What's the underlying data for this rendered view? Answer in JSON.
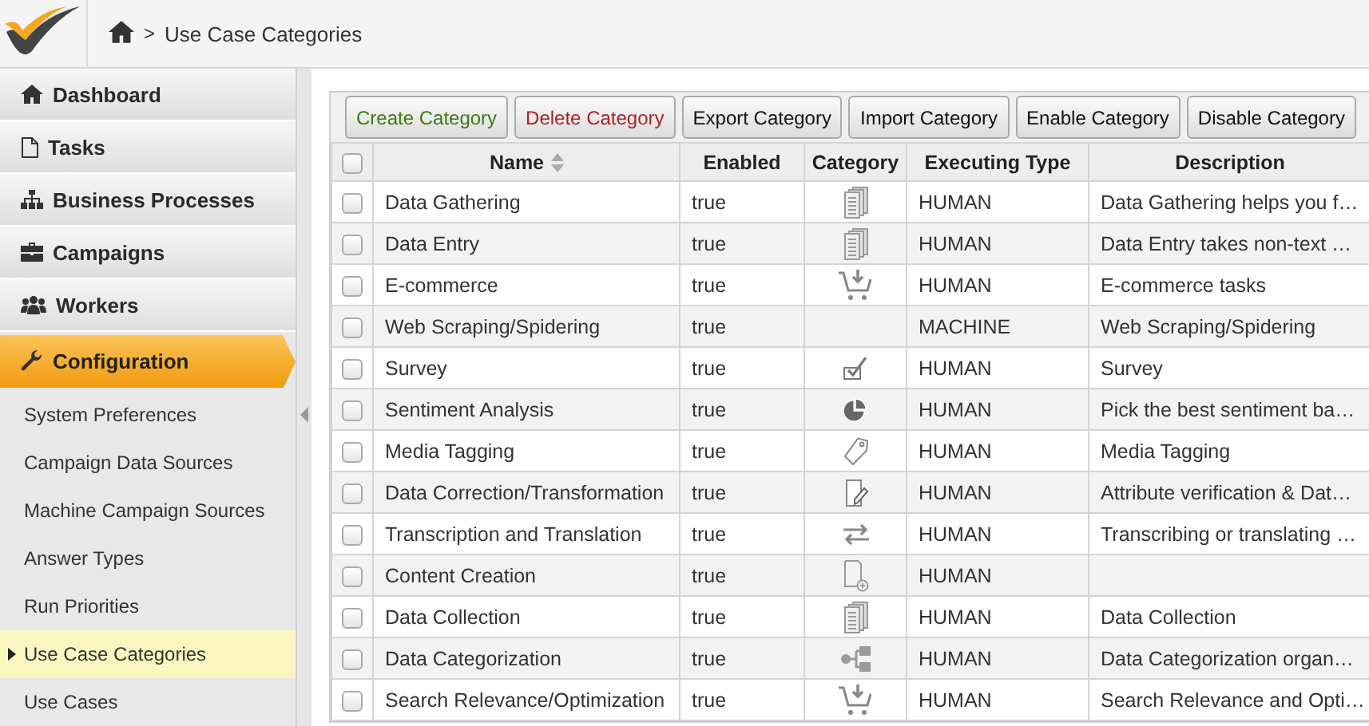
{
  "header": {
    "breadcrumb": [
      {
        "kind": "home"
      },
      {
        "kind": "separator",
        "label": ">"
      },
      {
        "kind": "page",
        "label": "Use Case Categories"
      }
    ]
  },
  "sidebar": {
    "items": [
      {
        "label": "Dashboard",
        "selected": false
      },
      {
        "label": "Tasks",
        "selected": false
      },
      {
        "label": "Business Processes",
        "selected": false
      },
      {
        "label": "Campaigns",
        "selected": false
      },
      {
        "label": "Workers",
        "selected": false
      },
      {
        "label": "Configuration",
        "selected": true
      }
    ],
    "subitems": [
      {
        "label": "System Preferences",
        "selected": false
      },
      {
        "label": "Campaign Data Sources",
        "selected": false
      },
      {
        "label": "Machine Campaign Sources",
        "selected": false
      },
      {
        "label": "Answer Types",
        "selected": false
      },
      {
        "label": "Run Priorities",
        "selected": false
      },
      {
        "label": "Use Case Categories",
        "selected": true
      },
      {
        "label": "Use Cases",
        "selected": false
      }
    ]
  },
  "toolbar": [
    {
      "label": "Create Category",
      "kind": "create"
    },
    {
      "label": "Delete Category",
      "kind": "delete"
    },
    {
      "label": "Export Category",
      "kind": "normal"
    },
    {
      "label": "Import Category",
      "kind": "normal"
    },
    {
      "label": "Enable Category",
      "kind": "normal"
    },
    {
      "label": "Disable Category",
      "kind": "normal"
    }
  ],
  "table": {
    "select_all": {
      "checked": false
    },
    "columns": [
      {
        "label": "Name"
      },
      {
        "label": "Enabled"
      },
      {
        "label": "Category"
      },
      {
        "label": "Executing Type"
      },
      {
        "label": "Description"
      }
    ],
    "rows": [
      {
        "checked": false,
        "name": "Data Gathering",
        "enabled": "true",
        "kind": "documents",
        "executing_type": "HUMAN",
        "description": "Data Gathering helps you f…"
      },
      {
        "checked": false,
        "name": "Data Entry",
        "enabled": "true",
        "kind": "documents",
        "executing_type": "HUMAN",
        "description": "Data Entry takes non-text …"
      },
      {
        "checked": false,
        "name": "E-commerce",
        "enabled": "true",
        "kind": "cart",
        "executing_type": "HUMAN",
        "description": "E-commerce tasks"
      },
      {
        "checked": false,
        "name": "Web Scraping/Spidering",
        "enabled": "true",
        "kind": "blank",
        "executing_type": "MACHINE",
        "description": "Web Scraping/Spidering"
      },
      {
        "checked": false,
        "name": "Survey",
        "enabled": "true",
        "kind": "check",
        "executing_type": "HUMAN",
        "description": "Survey"
      },
      {
        "checked": false,
        "name": "Sentiment Analysis",
        "enabled": "true",
        "kind": "pie",
        "executing_type": "HUMAN",
        "description": "Pick the best sentiment ba…"
      },
      {
        "checked": false,
        "name": "Media Tagging",
        "enabled": "true",
        "kind": "tag",
        "executing_type": "HUMAN",
        "description": "Media Tagging"
      },
      {
        "checked": false,
        "name": "Data Correction/Transformation",
        "enabled": "true",
        "kind": "edit",
        "executing_type": "HUMAN",
        "description": "Attribute verification & Dat…"
      },
      {
        "checked": false,
        "name": "Transcription and Translation",
        "enabled": "true",
        "kind": "arrows",
        "executing_type": "HUMAN",
        "description": "Transcribing or translating …"
      },
      {
        "checked": false,
        "name": "Content Creation",
        "enabled": "true",
        "kind": "newdoc",
        "executing_type": "HUMAN"
      },
      {
        "checked": false,
        "name": "Data Collection",
        "enabled": "true",
        "kind": "documents",
        "executing_type": "HUMAN",
        "description": "Data Collection"
      },
      {
        "checked": false,
        "name": "Data Categorization",
        "enabled": "true",
        "kind": "hierarchy",
        "executing_type": "HUMAN",
        "description": "Data Categorization organ…"
      },
      {
        "checked": false,
        "name": "Search Relevance/Optimization",
        "enabled": "true",
        "kind": "cart",
        "executing_type": "HUMAN",
        "description": "Search Relevance and Opti…"
      }
    ]
  }
}
